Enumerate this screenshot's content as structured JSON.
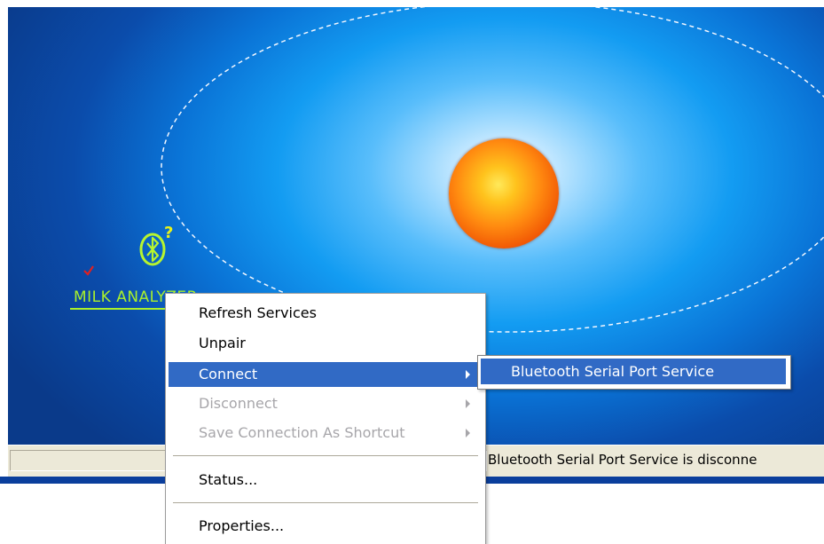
{
  "device": {
    "name": "MILK ANALYZER",
    "status_glyph": "?",
    "icon": "bluetooth-device-icon",
    "paired_mark": "check-icon"
  },
  "context_menu": {
    "items": [
      {
        "label": "Refresh Services",
        "state": "enabled"
      },
      {
        "label": "Unpair",
        "state": "enabled"
      },
      {
        "label": "Connect",
        "state": "selected",
        "has_submenu": true
      },
      {
        "label": "Disconnect",
        "state": "disabled",
        "has_submenu": true
      },
      {
        "label": "Save Connection As Shortcut",
        "state": "disabled",
        "has_submenu": true
      },
      {
        "label": "Status...",
        "state": "enabled"
      },
      {
        "label": "Properties...",
        "state": "enabled"
      }
    ]
  },
  "submenu": {
    "items": [
      {
        "label": "Bluetooth Serial Port Service",
        "state": "selected"
      }
    ]
  },
  "statusbar": {
    "text": "Bluetooth Serial Port Service is disconne"
  },
  "colors": {
    "menu_highlight": "#316ac5",
    "device_label": "#a8f02c",
    "sun": "#ff8a10",
    "background": "#0a73d6"
  }
}
